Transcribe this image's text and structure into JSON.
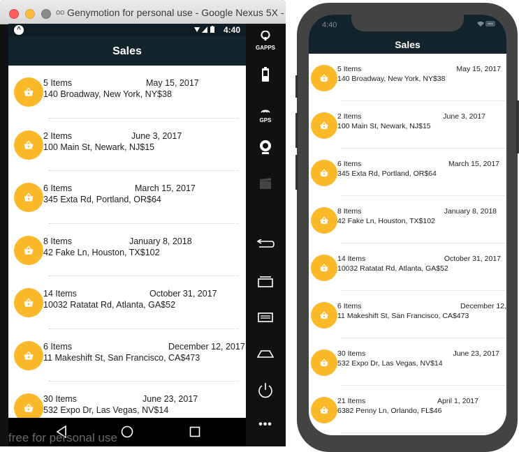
{
  "genymotion": {
    "window_title": "Genymotion for personal use - Google Nexus 5X -",
    "logo": "oo",
    "watermark": "free for personal use",
    "side_buttons": [
      {
        "icon": "gapps-icon",
        "label": "GAPPS"
      },
      {
        "icon": "battery-icon",
        "label": ""
      },
      {
        "icon": "gps-icon",
        "label": "GPS"
      },
      {
        "icon": "webcam-icon",
        "label": ""
      },
      {
        "icon": "clapper-icon",
        "label": ""
      },
      {
        "icon": "back-icon",
        "label": ""
      },
      {
        "icon": "recent-apps-icon",
        "label": ""
      },
      {
        "icon": "menu-icon",
        "label": ""
      },
      {
        "icon": "home-icon",
        "label": ""
      },
      {
        "icon": "power-icon",
        "label": ""
      },
      {
        "icon": "more-icon",
        "label": "•••"
      }
    ]
  },
  "android": {
    "status_time": "4:40",
    "header_title": "Sales",
    "sales": [
      {
        "items": "5 Items",
        "date": "May 15, 2017",
        "address": "140 Broadway, New York, NY$38"
      },
      {
        "items": "2 Items",
        "date": "June 3, 2017",
        "address": "100 Main St, Newark, NJ$15"
      },
      {
        "items": "6 Items",
        "date": "March 15, 2017",
        "address": "345 Exta Rd, Portland, OR$64"
      },
      {
        "items": "8 Items",
        "date": "January 8, 2018",
        "address": "42 Fake Ln, Houston, TX$102"
      },
      {
        "items": "14 Items",
        "date": "October 31, 2017",
        "address": "10032 Ratatat Rd, Atlanta, GA$52"
      },
      {
        "items": "6 Items",
        "date": "December 12, 2017",
        "address": "11 Makeshift St, San Francisco, CA$473"
      },
      {
        "items": "30 Items",
        "date": "June 23, 2017",
        "address": "532 Expo Dr, Las Vegas, NV$14"
      }
    ]
  },
  "ios": {
    "status_time": "4:40",
    "header_title": "Sales",
    "sales": [
      {
        "items": "5 Items",
        "date": "May 15, 2017",
        "address": "140 Broadway, New York, NY$38"
      },
      {
        "items": "2 Items",
        "date": "June 3, 2017",
        "address": "100 Main St, Newark, NJ$15"
      },
      {
        "items": "6 Items",
        "date": "March 15, 2017",
        "address": "345 Exta Rd, Portland, OR$64"
      },
      {
        "items": "8 Items",
        "date": "January 8, 2018",
        "address": "42 Fake Ln, Houston, TX$102"
      },
      {
        "items": "14 Items",
        "date": "October 31, 2017",
        "address": "10032 Ratatat Rd, Atlanta, GA$52"
      },
      {
        "items": "6 Items",
        "date": "December 12,",
        "address": "11 Makeshift St, San Francisco, CA$473"
      },
      {
        "items": "30 Items",
        "date": "June 23, 2017",
        "address": "532 Expo Dr, Las Vegas, NV$14"
      },
      {
        "items": "21 Items",
        "date": "April 1, 2017",
        "address": "6382 Penny Ln, Orlando, FL$46"
      }
    ]
  },
  "colors": {
    "header": "#13232c",
    "avatar": "#fbb829",
    "iphone_frame": "#434343"
  }
}
